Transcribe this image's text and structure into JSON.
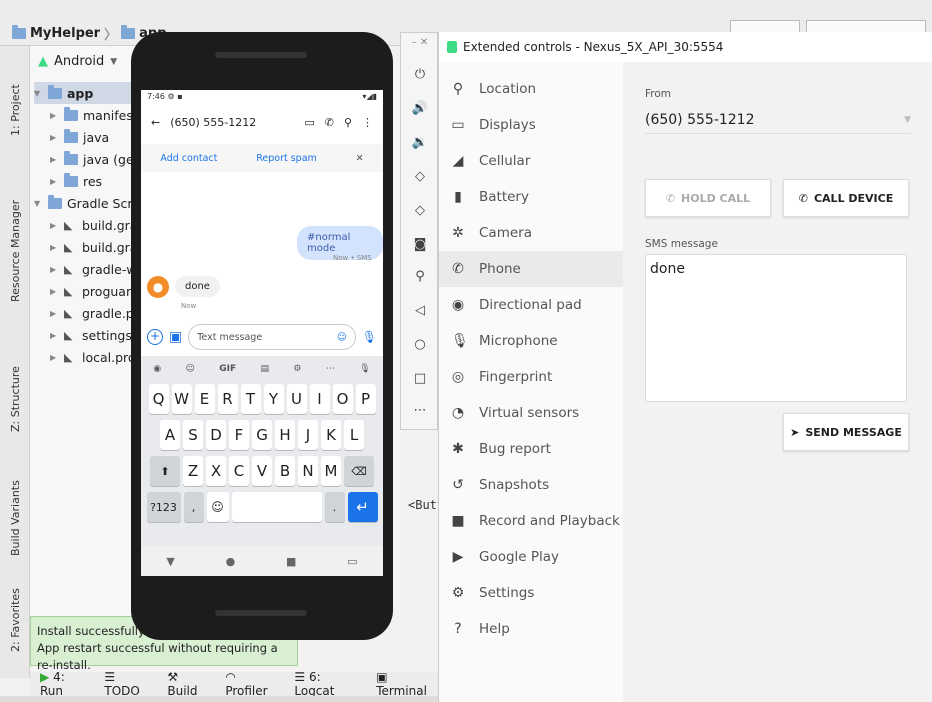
{
  "ide": {
    "breadcrumb": [
      "MyHelper",
      "app"
    ],
    "left_tabs": [
      "1: Project",
      "Resource Manager",
      "Z: Structure",
      "Build Variants",
      "2: Favorites"
    ],
    "project_view": "Android",
    "tree": [
      {
        "label": "app",
        "level": 0,
        "selected": true
      },
      {
        "label": "manifests",
        "level": 1
      },
      {
        "label": "java",
        "level": 1
      },
      {
        "label": "java (gen",
        "level": 1
      },
      {
        "label": "res",
        "level": 1
      },
      {
        "label": "Gradle Script",
        "level": 0
      },
      {
        "label": "build.grad",
        "level": 1
      },
      {
        "label": "build.grad",
        "level": 1
      },
      {
        "label": "gradle-wr",
        "level": 1
      },
      {
        "label": "proguard",
        "level": 1
      },
      {
        "label": "gradle.pro",
        "level": 1
      },
      {
        "label": "settings.g",
        "level": 1
      },
      {
        "label": "local.prop",
        "level": 1
      }
    ],
    "toast_line1": "Install successfully finished in 1 s 205 ms.",
    "toast_line2": "App restart successful without requiring a re-install.",
    "bottom_tabs": [
      "4: Run",
      "TODO",
      "Build",
      "Profiler",
      "6: Logcat",
      "Terminal"
    ],
    "code_fragment": "<Butt"
  },
  "phone": {
    "time": "7:46",
    "status_right": "▾◢▮",
    "contact_number": "(650) 555-1212",
    "add_contact": "Add contact",
    "report_spam": "Report spam",
    "outgoing_message": "#normal mode",
    "outgoing_meta": "Now • SMS",
    "incoming_message": "done",
    "incoming_meta": "Now",
    "compose_placeholder": "Text message",
    "gif_label": "GIF",
    "keyboard_row1": [
      "Q",
      "W",
      "E",
      "R",
      "T",
      "Y",
      "U",
      "I",
      "O",
      "P"
    ],
    "keyboard_row2": [
      "A",
      "S",
      "D",
      "F",
      "G",
      "H",
      "J",
      "K",
      "L"
    ],
    "keyboard_row3": [
      "Z",
      "X",
      "C",
      "V",
      "B",
      "N",
      "M"
    ],
    "key_123": "?123",
    "key_comma": ",",
    "key_period": "."
  },
  "extended": {
    "title": "Extended controls - Nexus_5X_API_30:5554",
    "nav": [
      {
        "label": "Location",
        "icon": "location-pin-icon",
        "glyph": "⚲"
      },
      {
        "label": "Displays",
        "icon": "display-icon",
        "glyph": "▭"
      },
      {
        "label": "Cellular",
        "icon": "signal-icon",
        "glyph": "◢"
      },
      {
        "label": "Battery",
        "icon": "battery-icon",
        "glyph": "▮"
      },
      {
        "label": "Camera",
        "icon": "camera-aperture-icon",
        "glyph": "✲"
      },
      {
        "label": "Phone",
        "icon": "phone-icon",
        "glyph": "✆",
        "selected": true
      },
      {
        "label": "Directional pad",
        "icon": "dpad-icon",
        "glyph": "◉"
      },
      {
        "label": "Microphone",
        "icon": "microphone-icon",
        "glyph": "🎙"
      },
      {
        "label": "Fingerprint",
        "icon": "fingerprint-icon",
        "glyph": "◎"
      },
      {
        "label": "Virtual sensors",
        "icon": "sensor-icon",
        "glyph": "◔"
      },
      {
        "label": "Bug report",
        "icon": "bug-icon",
        "glyph": "✱"
      },
      {
        "label": "Snapshots",
        "icon": "snapshot-history-icon",
        "glyph": "↺"
      },
      {
        "label": "Record and Playback",
        "icon": "video-record-icon",
        "glyph": "■"
      },
      {
        "label": "Google Play",
        "icon": "google-play-icon",
        "glyph": "▶"
      },
      {
        "label": "Settings",
        "icon": "gear-icon",
        "glyph": "⚙"
      },
      {
        "label": "Help",
        "icon": "help-icon",
        "glyph": "?"
      }
    ],
    "from_label": "From",
    "from_value": "(650) 555-1212",
    "hold_call": "HOLD CALL",
    "call_device": "CALL DEVICE",
    "sms_label": "SMS message",
    "sms_value": "done",
    "send_message": "SEND MESSAGE"
  }
}
